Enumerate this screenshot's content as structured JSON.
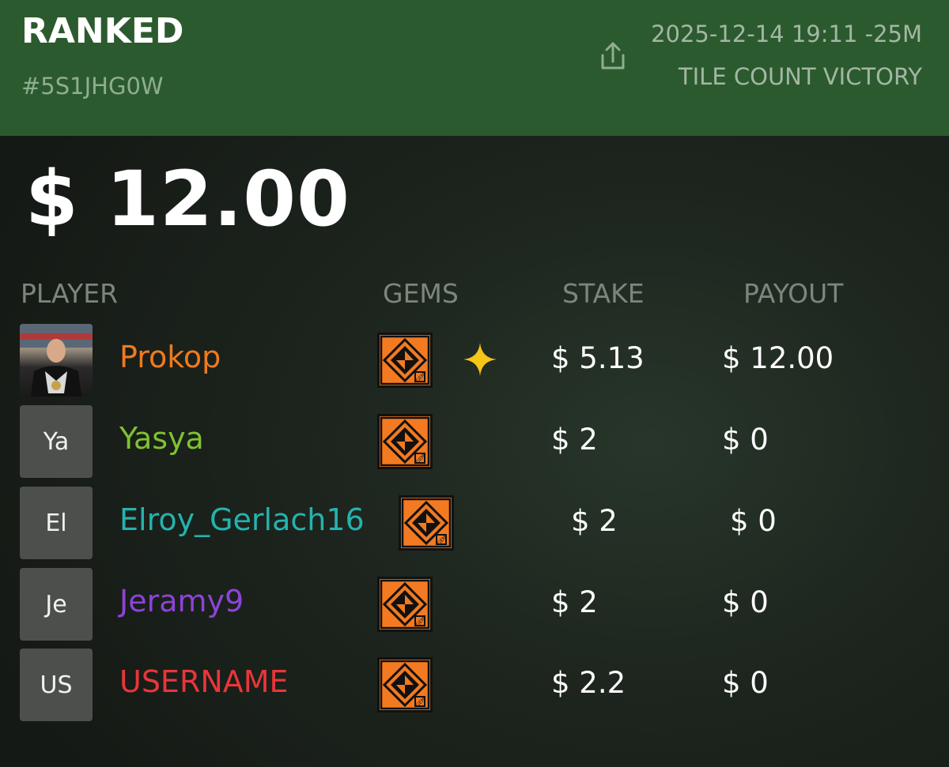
{
  "header": {
    "mode": "RANKED",
    "match_id": "#5S1JHG0W",
    "share_icon": "share-upload-icon",
    "date": "2025-12-14 19:11 -25M",
    "result": "TILE COUNT VICTORY"
  },
  "pot": "$ 12.00",
  "table": {
    "columns": {
      "player": "PLAYER",
      "gems": "GEMS",
      "stake": "STAKE",
      "payout": "PAYOUT"
    },
    "rows": [
      {
        "avatar": "",
        "avatar_type": "photo",
        "name": "Prokop",
        "name_color": "#f07a1e",
        "gem_icon": "gem-icon",
        "winner_icon": "star-icon",
        "stake": "$ 5.13",
        "payout": "$ 12.00"
      },
      {
        "avatar": "Ya",
        "avatar_type": "initials",
        "name": "Yasya",
        "name_color": "#7fc230",
        "gem_icon": "gem-icon",
        "stake": "$ 2",
        "payout": "$ 0"
      },
      {
        "avatar": "El",
        "avatar_type": "initials",
        "name": "Elroy_Gerlach16",
        "name_color": "#25b3ad",
        "gem_icon": "gem-icon",
        "stake": "$ 2",
        "payout": "$ 0"
      },
      {
        "avatar": "Je",
        "avatar_type": "initials",
        "name": "Jeramy9",
        "name_color": "#8d44d6",
        "gem_icon": "gem-icon",
        "stake": "$ 2",
        "payout": "$ 0"
      },
      {
        "avatar": "US",
        "avatar_type": "initials",
        "name": "USERNAME",
        "name_color": "#e8363a",
        "gem_icon": "gem-icon",
        "stake": "$ 2.2",
        "payout": "$ 0"
      }
    ]
  },
  "colors": {
    "header_bg": "#2c5a2f",
    "gem_orange": "#f37a21",
    "star_gold": "#f5c518"
  }
}
